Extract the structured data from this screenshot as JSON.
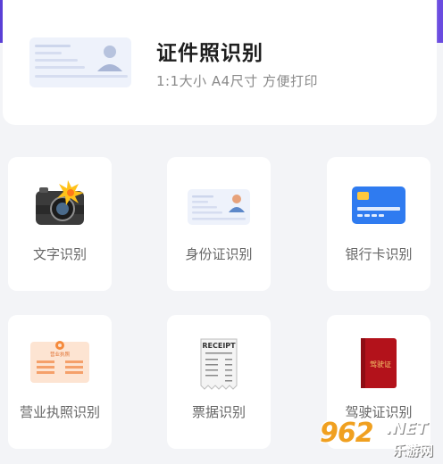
{
  "hero": {
    "title": "证件照识别",
    "subtitle": "1:1大小 A4尺寸 方便打印",
    "icon": "id-card-illustration"
  },
  "tiles": [
    {
      "label": "文字识别",
      "icon": "camera-flash-icon"
    },
    {
      "label": "身份证识别",
      "icon": "id-card-icon"
    },
    {
      "label": "银行卡识别",
      "icon": "bank-card-icon"
    },
    {
      "label": "营业执照识别",
      "icon": "business-license-icon"
    },
    {
      "label": "票据识别",
      "icon": "receipt-icon"
    },
    {
      "label": "驾驶证识别",
      "icon": "driver-license-icon"
    }
  ],
  "receipt": {
    "heading": "RECEIPT"
  },
  "license_book": {
    "text": "驾驶证"
  },
  "business_license": {
    "text": "营业执照"
  },
  "watermark": {
    "number": "962",
    "suffix": ".NET",
    "site": "乐游网"
  },
  "colors": {
    "accent": "#5a3fd6",
    "card_blue": "#2f7bf0",
    "license_red": "#b3121b",
    "license_orange": "#f58a3c",
    "watermark_orange": "#f0a020"
  }
}
